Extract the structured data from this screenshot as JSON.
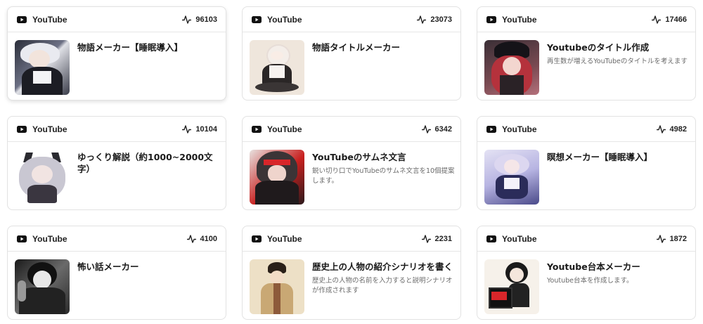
{
  "source_label": "YouTube",
  "colors": {
    "youtube_icon": "#111111",
    "border": "#e2e2e2",
    "desc_text": "#6a6a6a"
  },
  "cards": [
    {
      "count": "96103",
      "title": "物語メーカー【睡眠導入】",
      "description": ""
    },
    {
      "count": "23073",
      "title": "物語タイトルメーカー",
      "description": ""
    },
    {
      "count": "17466",
      "title": "Youtubeのタイトル作成",
      "description": "再生数が増えるYouTubeのタイトルを考えます"
    },
    {
      "count": "10104",
      "title": "ゆっくり解説（約1000~2000文字）",
      "description": ""
    },
    {
      "count": "6342",
      "title": "YouTubeのサムネ文言",
      "description": "鋭い切り口でYouTubeのサムネ文言を10個提案します。"
    },
    {
      "count": "4982",
      "title": "瞑想メーカー【睡眠導入】",
      "description": ""
    },
    {
      "count": "4100",
      "title": "怖い話メーカー",
      "description": ""
    },
    {
      "count": "2231",
      "title": "歴史上の人物の紹介シナリオを書く",
      "description": "歴史上の人物の名前を入力すると説明シナリオが作成されます"
    },
    {
      "count": "1872",
      "title": "Youtube台本メーカー",
      "description": "Youtube台本を作成します。"
    }
  ]
}
